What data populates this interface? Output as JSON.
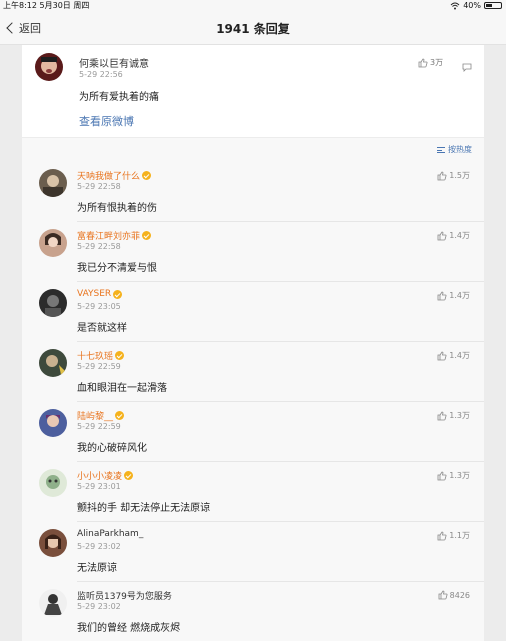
{
  "status_bar": {
    "time": "上午8:12",
    "date": "5月30日 周四",
    "battery": "40%"
  },
  "nav": {
    "back_label": "返回",
    "title": "1941 条回复"
  },
  "original": {
    "name": "何乘以巨有诚意",
    "time": "5-29 22:56",
    "text": "为所有爱执着的痛",
    "like_count": "3万",
    "view_original": "查看原微博"
  },
  "sort": {
    "label": "按热度"
  },
  "comments": [
    {
      "name": "天呐我做了什么",
      "time": "5-29 22:58",
      "text": "为所有恨执着的伤",
      "likes": "1.5万",
      "vip": true,
      "avatar_color": "#6b5e4e"
    },
    {
      "name": "富春江畔刘亦菲",
      "time": "5-29 22:58",
      "text": "我已分不清爱与恨",
      "likes": "1.4万",
      "vip": true,
      "avatar_color": "#c8a28d"
    },
    {
      "name": "VAYSER",
      "time": "5-29 23:05",
      "text": "是否就这样",
      "likes": "1.4万",
      "vip": true,
      "avatar_color": "#2b2b2b"
    },
    {
      "name": "十七玖瑶",
      "time": "5-29 22:59",
      "text": "血和眼泪在一起滑落",
      "likes": "1.4万",
      "vip": true,
      "avatar_color": "#3e4a3c"
    },
    {
      "name": "陆屿黎__",
      "time": "5-29 22:59",
      "text": "我的心破碎风化",
      "likes": "1.3万",
      "vip": true,
      "avatar_color": "#4d5f9e"
    },
    {
      "name": "小小小凌凌",
      "time": "5-29 23:01",
      "text": "颤抖的手 却无法停止无法原谅",
      "likes": "1.3万",
      "vip": true,
      "avatar_color": "#8fb08a"
    },
    {
      "name": "AlinaParkham_",
      "time": "5-29 23:02",
      "text": "无法原谅",
      "likes": "1.1万",
      "vip": false,
      "avatar_color": "#7a4f3c"
    },
    {
      "name": "监听员1379号为您服务",
      "time": "5-29 23:02",
      "text": "我们的曾经 燃烧成灰烬",
      "likes": "8426",
      "vip": false,
      "avatar_color": "#d8d8d8"
    }
  ]
}
